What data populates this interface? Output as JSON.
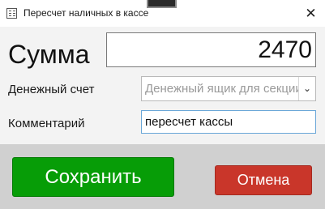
{
  "window": {
    "title": "Пересчет наличных в кассе",
    "close_glyph": "✕",
    "icon": "calculator-icon"
  },
  "form": {
    "amount_label": "Сумма",
    "amount_value": "2470",
    "account_label": "Денежный счет",
    "account_placeholder": "Денежный ящик для секции",
    "account_chevron": "⌄",
    "comment_label": "Комментарий",
    "comment_value": "пересчет кассы"
  },
  "footer": {
    "save_label": "Сохранить",
    "cancel_label": "Отмена",
    "save_color": "#079d07",
    "cancel_color": "#c9362a"
  }
}
